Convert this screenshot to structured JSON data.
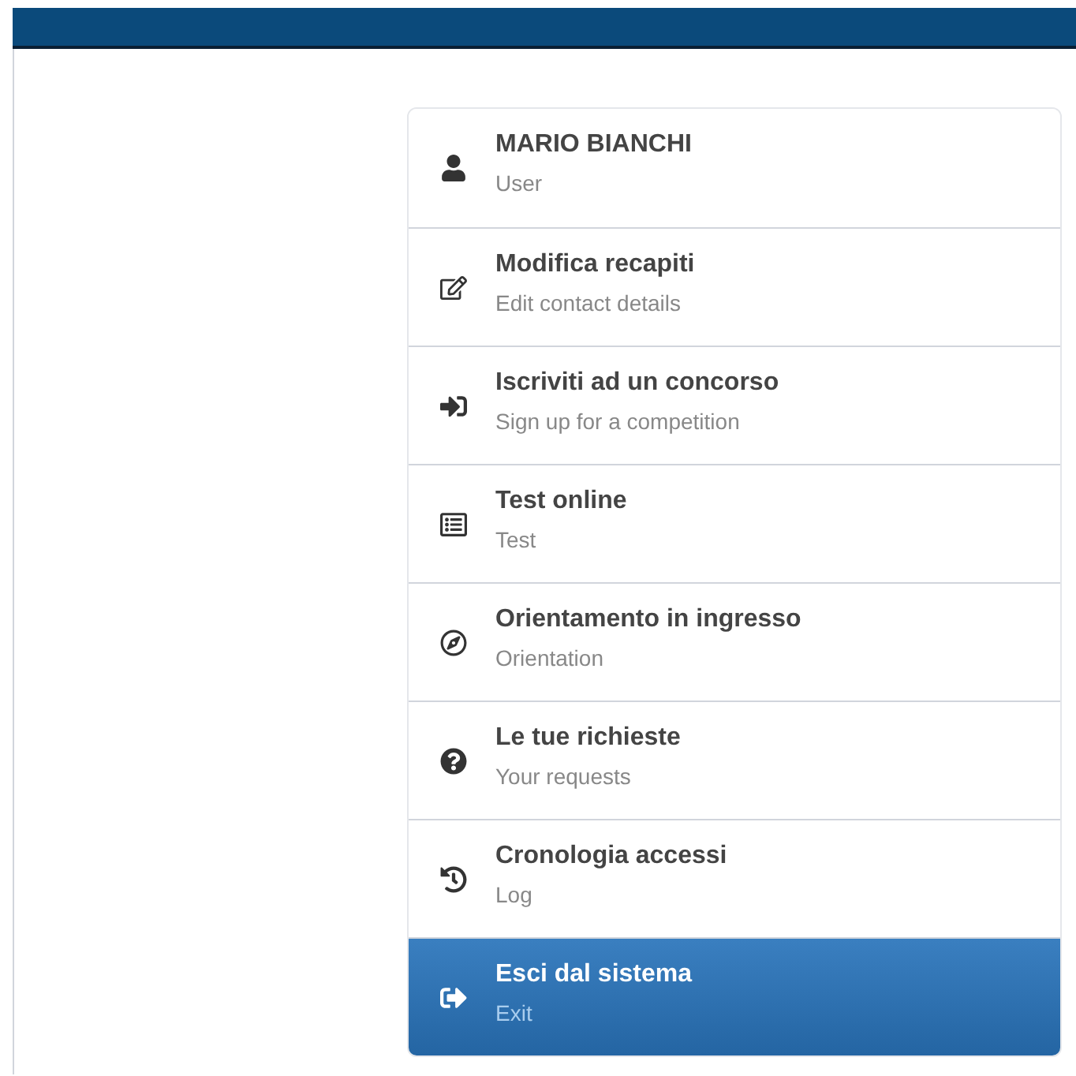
{
  "menu": [
    {
      "kind": "user",
      "title": "MARIO BIANCHI",
      "subtitle": "User",
      "selected": false
    },
    {
      "kind": "edit",
      "title": "Modifica recapiti",
      "subtitle": "Edit contact details",
      "selected": false
    },
    {
      "kind": "signin",
      "title": "Iscriviti ad un concorso",
      "subtitle": "Sign up for a competition",
      "selected": false
    },
    {
      "kind": "test",
      "title": "Test online",
      "subtitle": "Test",
      "selected": false
    },
    {
      "kind": "compass",
      "title": "Orientamento in ingresso",
      "subtitle": "Orientation",
      "selected": false
    },
    {
      "kind": "question",
      "title": "Le tue richieste",
      "subtitle": "Your requests",
      "selected": false
    },
    {
      "kind": "history",
      "title": "Cronologia accessi",
      "subtitle": "Log",
      "selected": false
    },
    {
      "kind": "signout",
      "title": "Esci dal sistema",
      "subtitle": "Exit",
      "selected": true
    }
  ]
}
